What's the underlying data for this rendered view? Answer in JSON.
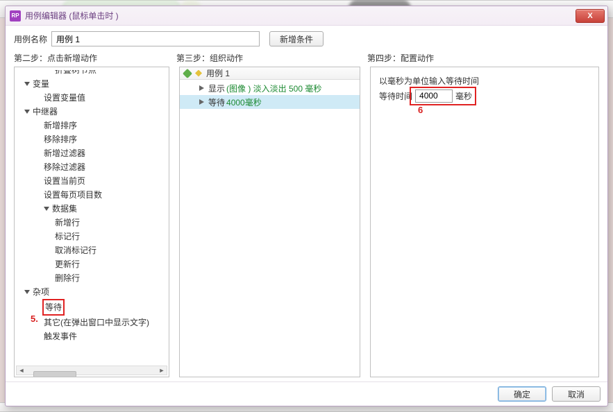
{
  "window": {
    "app_icon_text": "RP",
    "title": "用例编辑器 (鼠标单击时 )",
    "close_glyph": "X"
  },
  "case": {
    "name_label": "用例名称",
    "name_value": "用例 1",
    "add_condition_label": "新增条件"
  },
  "steps": {
    "s1": "第二步：点击新增动作",
    "s2": "第三步：组织动作",
    "s3": "第四步：配置动作"
  },
  "tree_top_clipped": "折叠树节点",
  "tree": [
    {
      "type": "group",
      "label": "变量",
      "children": [
        {
          "label": "设置变量值"
        }
      ]
    },
    {
      "type": "group",
      "label": "中继器",
      "children": [
        {
          "label": "新增排序"
        },
        {
          "label": "移除排序"
        },
        {
          "label": "新增过滤器"
        },
        {
          "label": "移除过滤器"
        },
        {
          "label": "设置当前页"
        },
        {
          "label": "设置每页项目数"
        },
        {
          "type": "group",
          "label": "数据集",
          "children": [
            {
              "label": "新增行"
            },
            {
              "label": "标记行"
            },
            {
              "label": "取消标记行"
            },
            {
              "label": "更新行"
            },
            {
              "label": "删除行"
            }
          ]
        }
      ]
    },
    {
      "type": "group",
      "label": "杂项",
      "children": [
        {
          "label": "等待",
          "highlighted": true
        },
        {
          "label": "其它(在弹出窗口中显示文字)"
        },
        {
          "label": "触发事件"
        }
      ]
    }
  ],
  "annotations": {
    "n5": "5.",
    "n6": "6"
  },
  "organize": {
    "case_label": "用例 1",
    "actions": [
      {
        "prefix": "显示",
        "rest": " (图像 ) 淡入淡出  500 毫秒",
        "selected": false
      },
      {
        "prefix": "等待",
        "rest": "4000毫秒",
        "selected": true
      }
    ]
  },
  "configure": {
    "hint": "以毫秒为单位输入等待时间",
    "wait_label": "等待时间",
    "wait_value": "4000",
    "unit": "毫秒"
  },
  "footer": {
    "ok": "确定",
    "cancel": "取消"
  },
  "hscroll": {
    "left": "◄",
    "right": "►"
  }
}
